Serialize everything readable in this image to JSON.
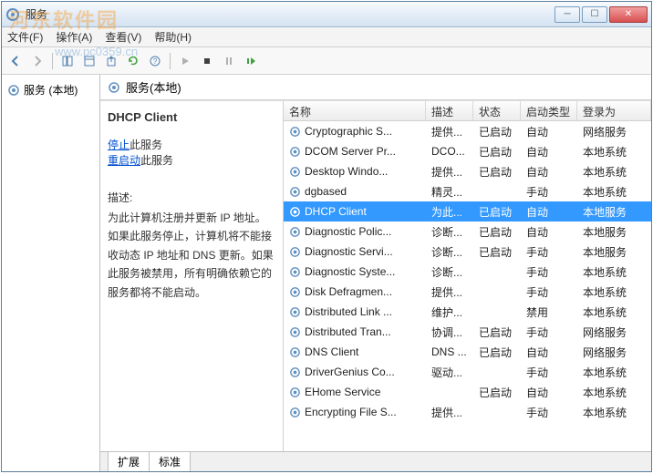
{
  "window": {
    "title": "服务"
  },
  "menubar": {
    "file": "文件(F)",
    "action": "操作(A)",
    "view": "查看(V)",
    "help": "帮助(H)"
  },
  "left": {
    "label": "服务 (本地)"
  },
  "right": {
    "header": "服务(本地)",
    "detail": {
      "title": "DHCP Client",
      "stop_link": "停止",
      "stop_suffix": "此服务",
      "restart_link": "重启动",
      "restart_suffix": "此服务",
      "desc_label": "描述:",
      "desc": "为此计算机注册并更新 IP 地址。如果此服务停止，计算机将不能接收动态 IP 地址和 DNS 更新。如果此服务被禁用，所有明确依赖它的服务都将不能启动。"
    },
    "columns": {
      "name": "名称",
      "desc": "描述",
      "status": "状态",
      "start": "启动类型",
      "logon": "登录为"
    },
    "rows": [
      {
        "name": "Cryptographic S...",
        "desc": "提供...",
        "status": "已启动",
        "start": "自动",
        "logon": "网络服务",
        "selected": false
      },
      {
        "name": "DCOM Server Pr...",
        "desc": "DCO...",
        "status": "已启动",
        "start": "自动",
        "logon": "本地系统",
        "selected": false
      },
      {
        "name": "Desktop Windo...",
        "desc": "提供...",
        "status": "已启动",
        "start": "自动",
        "logon": "本地系统",
        "selected": false
      },
      {
        "name": "dgbased",
        "desc": "精灵...",
        "status": "",
        "start": "手动",
        "logon": "本地系统",
        "selected": false
      },
      {
        "name": "DHCP Client",
        "desc": "为此...",
        "status": "已启动",
        "start": "自动",
        "logon": "本地服务",
        "selected": true
      },
      {
        "name": "Diagnostic Polic...",
        "desc": "诊断...",
        "status": "已启动",
        "start": "自动",
        "logon": "本地服务",
        "selected": false
      },
      {
        "name": "Diagnostic Servi...",
        "desc": "诊断...",
        "status": "已启动",
        "start": "手动",
        "logon": "本地服务",
        "selected": false
      },
      {
        "name": "Diagnostic Syste...",
        "desc": "诊断...",
        "status": "",
        "start": "手动",
        "logon": "本地系统",
        "selected": false
      },
      {
        "name": "Disk Defragmen...",
        "desc": "提供...",
        "status": "",
        "start": "手动",
        "logon": "本地系统",
        "selected": false
      },
      {
        "name": "Distributed Link ...",
        "desc": "维护...",
        "status": "",
        "start": "禁用",
        "logon": "本地系统",
        "selected": false
      },
      {
        "name": "Distributed Tran...",
        "desc": "协调...",
        "status": "已启动",
        "start": "手动",
        "logon": "网络服务",
        "selected": false
      },
      {
        "name": "DNS Client",
        "desc": "DNS ...",
        "status": "已启动",
        "start": "自动",
        "logon": "网络服务",
        "selected": false
      },
      {
        "name": "DriverGenius Co...",
        "desc": "驱动...",
        "status": "",
        "start": "手动",
        "logon": "本地系统",
        "selected": false
      },
      {
        "name": "EHome Service",
        "desc": "",
        "status": "已启动",
        "start": "自动",
        "logon": "本地系统",
        "selected": false
      },
      {
        "name": "Encrypting File S...",
        "desc": "提供...",
        "status": "",
        "start": "手动",
        "logon": "本地系统",
        "selected": false
      }
    ],
    "tabs": {
      "extended": "扩展",
      "standard": "标准"
    }
  },
  "watermark": {
    "main": "河东软件园",
    "url": "www.pc0359.cn"
  }
}
